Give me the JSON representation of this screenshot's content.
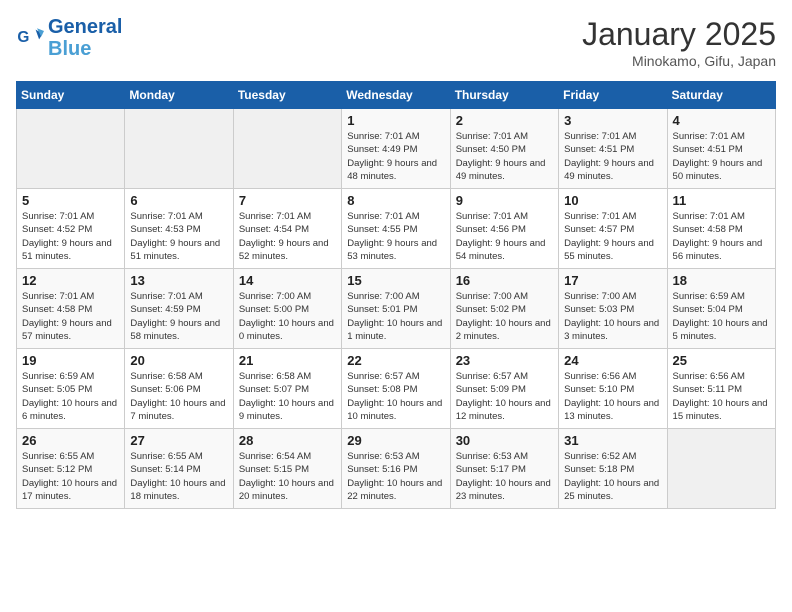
{
  "header": {
    "logo_line1": "General",
    "logo_line2": "Blue",
    "month": "January 2025",
    "location": "Minokamo, Gifu, Japan"
  },
  "days_of_week": [
    "Sunday",
    "Monday",
    "Tuesday",
    "Wednesday",
    "Thursday",
    "Friday",
    "Saturday"
  ],
  "weeks": [
    [
      {
        "day": "",
        "empty": true
      },
      {
        "day": "",
        "empty": true
      },
      {
        "day": "",
        "empty": true
      },
      {
        "day": "1",
        "sunrise": "7:01 AM",
        "sunset": "4:49 PM",
        "daylight": "9 hours and 48 minutes."
      },
      {
        "day": "2",
        "sunrise": "7:01 AM",
        "sunset": "4:50 PM",
        "daylight": "9 hours and 49 minutes."
      },
      {
        "day": "3",
        "sunrise": "7:01 AM",
        "sunset": "4:51 PM",
        "daylight": "9 hours and 49 minutes."
      },
      {
        "day": "4",
        "sunrise": "7:01 AM",
        "sunset": "4:51 PM",
        "daylight": "9 hours and 50 minutes."
      }
    ],
    [
      {
        "day": "5",
        "sunrise": "7:01 AM",
        "sunset": "4:52 PM",
        "daylight": "9 hours and 51 minutes."
      },
      {
        "day": "6",
        "sunrise": "7:01 AM",
        "sunset": "4:53 PM",
        "daylight": "9 hours and 51 minutes."
      },
      {
        "day": "7",
        "sunrise": "7:01 AM",
        "sunset": "4:54 PM",
        "daylight": "9 hours and 52 minutes."
      },
      {
        "day": "8",
        "sunrise": "7:01 AM",
        "sunset": "4:55 PM",
        "daylight": "9 hours and 53 minutes."
      },
      {
        "day": "9",
        "sunrise": "7:01 AM",
        "sunset": "4:56 PM",
        "daylight": "9 hours and 54 minutes."
      },
      {
        "day": "10",
        "sunrise": "7:01 AM",
        "sunset": "4:57 PM",
        "daylight": "9 hours and 55 minutes."
      },
      {
        "day": "11",
        "sunrise": "7:01 AM",
        "sunset": "4:58 PM",
        "daylight": "9 hours and 56 minutes."
      }
    ],
    [
      {
        "day": "12",
        "sunrise": "7:01 AM",
        "sunset": "4:58 PM",
        "daylight": "9 hours and 57 minutes."
      },
      {
        "day": "13",
        "sunrise": "7:01 AM",
        "sunset": "4:59 PM",
        "daylight": "9 hours and 58 minutes."
      },
      {
        "day": "14",
        "sunrise": "7:00 AM",
        "sunset": "5:00 PM",
        "daylight": "10 hours and 0 minutes."
      },
      {
        "day": "15",
        "sunrise": "7:00 AM",
        "sunset": "5:01 PM",
        "daylight": "10 hours and 1 minute."
      },
      {
        "day": "16",
        "sunrise": "7:00 AM",
        "sunset": "5:02 PM",
        "daylight": "10 hours and 2 minutes."
      },
      {
        "day": "17",
        "sunrise": "7:00 AM",
        "sunset": "5:03 PM",
        "daylight": "10 hours and 3 minutes."
      },
      {
        "day": "18",
        "sunrise": "6:59 AM",
        "sunset": "5:04 PM",
        "daylight": "10 hours and 5 minutes."
      }
    ],
    [
      {
        "day": "19",
        "sunrise": "6:59 AM",
        "sunset": "5:05 PM",
        "daylight": "10 hours and 6 minutes."
      },
      {
        "day": "20",
        "sunrise": "6:58 AM",
        "sunset": "5:06 PM",
        "daylight": "10 hours and 7 minutes."
      },
      {
        "day": "21",
        "sunrise": "6:58 AM",
        "sunset": "5:07 PM",
        "daylight": "10 hours and 9 minutes."
      },
      {
        "day": "22",
        "sunrise": "6:57 AM",
        "sunset": "5:08 PM",
        "daylight": "10 hours and 10 minutes."
      },
      {
        "day": "23",
        "sunrise": "6:57 AM",
        "sunset": "5:09 PM",
        "daylight": "10 hours and 12 minutes."
      },
      {
        "day": "24",
        "sunrise": "6:56 AM",
        "sunset": "5:10 PM",
        "daylight": "10 hours and 13 minutes."
      },
      {
        "day": "25",
        "sunrise": "6:56 AM",
        "sunset": "5:11 PM",
        "daylight": "10 hours and 15 minutes."
      }
    ],
    [
      {
        "day": "26",
        "sunrise": "6:55 AM",
        "sunset": "5:12 PM",
        "daylight": "10 hours and 17 minutes."
      },
      {
        "day": "27",
        "sunrise": "6:55 AM",
        "sunset": "5:14 PM",
        "daylight": "10 hours and 18 minutes."
      },
      {
        "day": "28",
        "sunrise": "6:54 AM",
        "sunset": "5:15 PM",
        "daylight": "10 hours and 20 minutes."
      },
      {
        "day": "29",
        "sunrise": "6:53 AM",
        "sunset": "5:16 PM",
        "daylight": "10 hours and 22 minutes."
      },
      {
        "day": "30",
        "sunrise": "6:53 AM",
        "sunset": "5:17 PM",
        "daylight": "10 hours and 23 minutes."
      },
      {
        "day": "31",
        "sunrise": "6:52 AM",
        "sunset": "5:18 PM",
        "daylight": "10 hours and 25 minutes."
      },
      {
        "day": "",
        "empty": true
      }
    ]
  ]
}
